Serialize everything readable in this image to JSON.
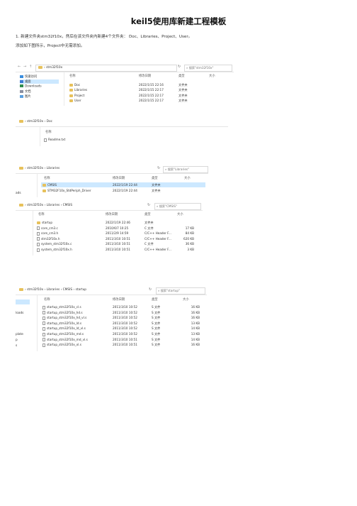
{
  "title": "keil5使用库新建工程模板",
  "para1": "1. 新建文件夹stm32f10x，然后在该文件夹内新建4个文件夹： Doc、Libraries、Project、User。",
  "para2": "添加如下图所示，Project中无需添加。",
  "colors": {
    "folder": "#e7c15b",
    "selected_row": "#cce8ff"
  },
  "icons": [
    "back-arrow-icon",
    "forward-arrow-icon",
    "up-arrow-icon",
    "folder-icon",
    "refresh-icon",
    "search-icon",
    "document-icon"
  ],
  "shot1": {
    "path": [
      "stm32f10x"
    ],
    "search": "搜索\"stm32f10x\"",
    "headers": {
      "name": "名称",
      "date": "修改日期",
      "type": "类型",
      "size": "大小"
    },
    "sidebar": [
      "快速访问",
      "桌面",
      "Downloads",
      "文档",
      "图片"
    ],
    "rows": [
      {
        "name": "Doc",
        "date": "2022/1/15 22:16",
        "type": "文件夹",
        "size": ""
      },
      {
        "name": "Libraries",
        "date": "2022/1/15 22:17",
        "type": "文件夹",
        "size": ""
      },
      {
        "name": "Project",
        "date": "2022/1/15 22:17",
        "type": "文件夹",
        "size": ""
      },
      {
        "name": "User",
        "date": "2022/1/15 22:17",
        "type": "文件夹",
        "size": ""
      }
    ]
  },
  "shot2": {
    "path": [
      "stm32f10x",
      "Doc"
    ],
    "headers": {
      "name": "名称"
    },
    "rows": [
      {
        "name": "Readme.txt"
      }
    ]
  },
  "shot3": {
    "path": [
      "stm32f10x",
      "Libraries"
    ],
    "search": "搜索\"Libraries\"",
    "headers": {
      "name": "名称",
      "date": "修改日期",
      "type": "类型",
      "size": "大小"
    },
    "sidebar_fragment": "ads",
    "rows": [
      {
        "name": "CMSIS",
        "date": "2022/1/19 22:44",
        "type": "文件夹",
        "size": ""
      },
      {
        "name": "STM32F10x_StdPeriph_Driver",
        "date": "2022/1/19 22:44",
        "type": "文件夹",
        "size": ""
      }
    ]
  },
  "shot4": {
    "path": [
      "stm32f10x",
      "Libraries",
      "CMSIS"
    ],
    "search": "搜索\"CMSIS\"",
    "headers": {
      "name": "名称",
      "date": "修改日期",
      "type": "类型",
      "size": "大小"
    },
    "rows": [
      {
        "name": "startup",
        "date": "2022/1/19 22:46",
        "type": "文件夹",
        "size": ""
      },
      {
        "name": "core_cm3.c",
        "date": "2010/6/7 10:25",
        "type": "C 文件",
        "size": "17 KB"
      },
      {
        "name": "core_cm3.h",
        "date": "2011/2/9 14:59",
        "type": "C/C++ Header F...",
        "size": "84 KB"
      },
      {
        "name": "stm32f10x.h",
        "date": "2011/3/10 10:51",
        "type": "C/C++ Header F...",
        "size": "620 KB"
      },
      {
        "name": "system_stm32f10x.c",
        "date": "2011/3/10 10:51",
        "type": "C 文件",
        "size": "36 KB"
      },
      {
        "name": "system_stm32f10x.h",
        "date": "2011/3/10 10:51",
        "type": "C/C++ Header F...",
        "size": "3 KB"
      }
    ]
  },
  "shot5": {
    "path": [
      "stm32f10x",
      "Libraries",
      "CMSIS",
      "startup"
    ],
    "search": "搜索\"startup\"",
    "headers": {
      "name": "名称",
      "date": "修改日期",
      "type": "类型",
      "size": "大小"
    },
    "sidebar_fragments": [
      "loads",
      "plate",
      "p",
      "s"
    ],
    "rows": [
      {
        "name": "startup_stm32f10x_cl.s",
        "date": "2011/3/10 10:52",
        "type": "S 文件",
        "size": "16 KB"
      },
      {
        "name": "startup_stm32f10x_hd.s",
        "date": "2011/3/10 10:52",
        "type": "S 文件",
        "size": "16 KB"
      },
      {
        "name": "startup_stm32f10x_hd_vl.s",
        "date": "2011/3/10 10:52",
        "type": "S 文件",
        "size": "16 KB"
      },
      {
        "name": "startup_stm32f10x_ld.s",
        "date": "2011/3/10 10:52",
        "type": "S 文件",
        "size": "13 KB"
      },
      {
        "name": "startup_stm32f10x_ld_vl.s",
        "date": "2011/3/10 10:52",
        "type": "S 文件",
        "size": "14 KB"
      },
      {
        "name": "startup_stm32f10x_md.s",
        "date": "2011/3/10 10:52",
        "type": "S 文件",
        "size": "13 KB"
      },
      {
        "name": "startup_stm32f10x_md_vl.s",
        "date": "2011/3/10 10:51",
        "type": "S 文件",
        "size": "14 KB"
      },
      {
        "name": "startup_stm32f10x_xl.s",
        "date": "2011/3/10 10:51",
        "type": "S 文件",
        "size": "16 KB"
      }
    ]
  }
}
